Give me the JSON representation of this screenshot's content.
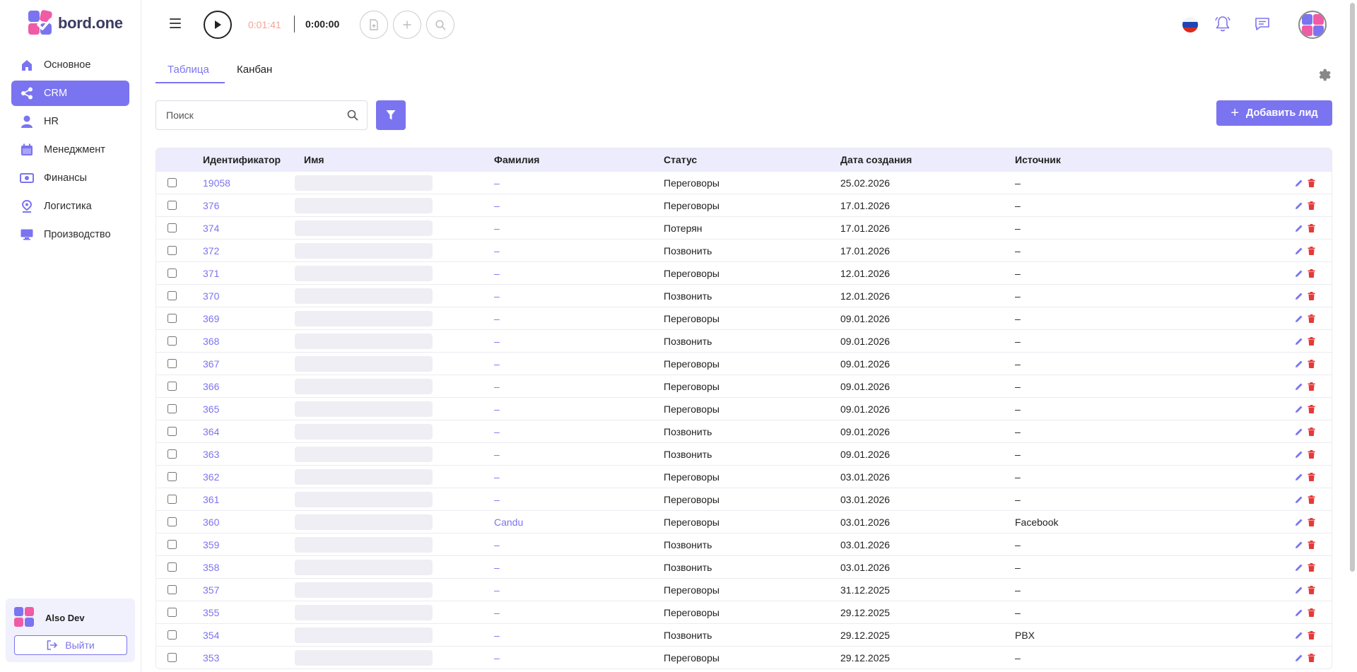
{
  "app": {
    "logo_text": "bord.one"
  },
  "sidebar": {
    "items": [
      {
        "label": "Основное",
        "icon": "home-icon",
        "active": false
      },
      {
        "label": "CRM",
        "icon": "share-icon",
        "active": true
      },
      {
        "label": "HR",
        "icon": "person-icon",
        "active": false
      },
      {
        "label": "Менеджмент",
        "icon": "calendar-icon",
        "active": false
      },
      {
        "label": "Финансы",
        "icon": "money-icon",
        "active": false
      },
      {
        "label": "Логистика",
        "icon": "location-icon",
        "active": false
      },
      {
        "label": "Производство",
        "icon": "monitor-icon",
        "active": false
      }
    ],
    "user": {
      "name": "Also Dev",
      "logout_label": "Выйти"
    }
  },
  "header": {
    "timer_current": "0:01:41",
    "timer_total": "0:00:00",
    "language": "RU"
  },
  "tabs": {
    "table_label": "Таблица",
    "kanban_label": "Канбан"
  },
  "search": {
    "placeholder": "Поиск"
  },
  "add_lead_label": "Добавить лид",
  "table": {
    "columns": {
      "id": "Идентификатор",
      "name": "Имя",
      "surname": "Фамилия",
      "status": "Статус",
      "created": "Дата создания",
      "source": "Источник"
    },
    "rows": [
      {
        "id": "19058",
        "surname": "–",
        "status": "Переговоры",
        "created": "25.02.2026",
        "source": "–"
      },
      {
        "id": "376",
        "surname": "–",
        "status": "Переговоры",
        "created": "17.01.2026",
        "source": "–"
      },
      {
        "id": "374",
        "surname": "–",
        "status": "Потерян",
        "created": "17.01.2026",
        "source": "–"
      },
      {
        "id": "372",
        "surname": "–",
        "status": "Позвонить",
        "created": "17.01.2026",
        "source": "–"
      },
      {
        "id": "371",
        "surname": "–",
        "status": "Переговоры",
        "created": "12.01.2026",
        "source": "–"
      },
      {
        "id": "370",
        "surname": "–",
        "status": "Позвонить",
        "created": "12.01.2026",
        "source": "–"
      },
      {
        "id": "369",
        "surname": "–",
        "status": "Переговоры",
        "created": "09.01.2026",
        "source": "–"
      },
      {
        "id": "368",
        "surname": "–",
        "status": "Позвонить",
        "created": "09.01.2026",
        "source": "–"
      },
      {
        "id": "367",
        "surname": "–",
        "status": "Переговоры",
        "created": "09.01.2026",
        "source": "–"
      },
      {
        "id": "366",
        "surname": "–",
        "status": "Переговоры",
        "created": "09.01.2026",
        "source": "–"
      },
      {
        "id": "365",
        "surname": "–",
        "status": "Переговоры",
        "created": "09.01.2026",
        "source": "–"
      },
      {
        "id": "364",
        "surname": "–",
        "status": "Позвонить",
        "created": "09.01.2026",
        "source": "–"
      },
      {
        "id": "363",
        "surname": "–",
        "status": "Позвонить",
        "created": "09.01.2026",
        "source": "–"
      },
      {
        "id": "362",
        "surname": "–",
        "status": "Переговоры",
        "created": "03.01.2026",
        "source": "–"
      },
      {
        "id": "361",
        "surname": "–",
        "status": "Переговоры",
        "created": "03.01.2026",
        "source": "–"
      },
      {
        "id": "360",
        "surname": "Candu",
        "status": "Переговоры",
        "created": "03.01.2026",
        "source": "Facebook"
      },
      {
        "id": "359",
        "surname": "–",
        "status": "Позвонить",
        "created": "03.01.2026",
        "source": "–"
      },
      {
        "id": "358",
        "surname": "–",
        "status": "Позвонить",
        "created": "03.01.2026",
        "source": "–"
      },
      {
        "id": "357",
        "surname": "–",
        "status": "Переговоры",
        "created": "31.12.2025",
        "source": "–"
      },
      {
        "id": "355",
        "surname": "–",
        "status": "Переговоры",
        "created": "29.12.2025",
        "source": "–"
      },
      {
        "id": "354",
        "surname": "–",
        "status": "Позвонить",
        "created": "29.12.2025",
        "source": "PBX"
      },
      {
        "id": "353",
        "surname": "–",
        "status": "Переговоры",
        "created": "29.12.2025",
        "source": "–"
      }
    ]
  },
  "colors": {
    "accent": "#7b74f0",
    "delete": "#e5393a",
    "timer": "#f2a598"
  }
}
